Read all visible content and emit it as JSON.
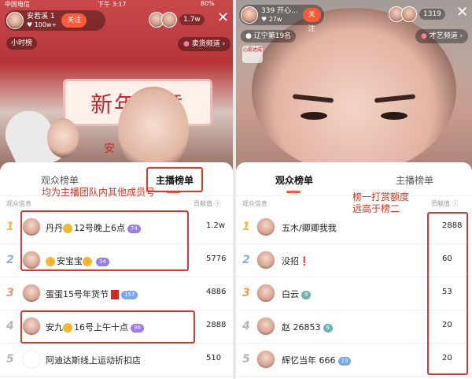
{
  "left": {
    "status": {
      "carrier": "中国电信",
      "time": "下午 3:17",
      "battery": "80%"
    },
    "host": {
      "name": "安若溪 1",
      "likes": "100w+",
      "follow": "关注"
    },
    "viewer_count": "1.7w",
    "close_icon": "✕",
    "hourly_tag": "小时榜",
    "channel": {
      "icon": "heart",
      "label": "卖货频道",
      "arrow": "›"
    },
    "banner_text": "新年立意",
    "banner_sub": "安",
    "tabs": {
      "audience": "观众榜单",
      "host": "主播榜单"
    },
    "header": {
      "info": "观众信息",
      "value": "贡献值 ⓘ"
    },
    "rows": [
      {
        "rank": "1",
        "rank_color": "#f3b63a",
        "name_pre": "丹丹",
        "name_post": "12号晚上6点",
        "level": "74",
        "level_kind": "p",
        "value": "1.2w",
        "emoji_pre": false,
        "emoji_mid": true,
        "emoji_post": false,
        "redbox": false
      },
      {
        "rank": "2",
        "rank_color": "#8fb0e6",
        "name_pre": "",
        "name_post": "安宝宝",
        "level": "34",
        "level_kind": "p",
        "value": "5776",
        "emoji_pre": true,
        "emoji_mid": false,
        "emoji_post": true,
        "redbox": false
      },
      {
        "rank": "3",
        "rank_color": "#e99b57",
        "name_pre": "",
        "name_post": "蛋蛋15号年货节",
        "level": "157",
        "level_kind": "b",
        "value": "4886",
        "emoji_pre": false,
        "emoji_mid": false,
        "emoji_post": false,
        "redbox": true
      },
      {
        "rank": "4",
        "rank_color": "#b5b5b5",
        "name_pre": "安九",
        "name_post": "16号上午十点",
        "level": "96",
        "level_kind": "p",
        "value": "2888",
        "emoji_pre": false,
        "emoji_mid": true,
        "emoji_post": false,
        "redbox": false
      },
      {
        "rank": "5",
        "rank_color": "#b5b5b5",
        "name_pre": "",
        "name_post": "阿迪达斯线上运动折扣店",
        "level": "",
        "level_kind": "",
        "value": "510",
        "emoji_pre": false,
        "emoji_mid": false,
        "emoji_post": false,
        "redbox": false
      }
    ],
    "annotation": "均为主播团队内其他成员号"
  },
  "right": {
    "host": {
      "name": "339 开心...",
      "likes": "27w",
      "follow": "关注"
    },
    "viewer_count": "1319",
    "close_icon": "✕",
    "region_tag": "辽宁第19名",
    "badge": "心愿达成",
    "channel": {
      "icon": "heart",
      "label": "才艺频道",
      "arrow": "›"
    },
    "tabs": {
      "audience": "观众榜单",
      "host": "主播榜单"
    },
    "header": {
      "info": "观众信息",
      "value": "贡献值 ⓘ"
    },
    "rows": [
      {
        "rank": "1",
        "rank_color": "#f3b63a",
        "name": "五木/卿卿我我",
        "level": "",
        "level_kind": "",
        "value": "2888",
        "mark": ""
      },
      {
        "rank": "2",
        "rank_color": "#8fb0e6",
        "name": "没招",
        "level": "",
        "level_kind": "",
        "value": "60",
        "mark": "❗"
      },
      {
        "rank": "3",
        "rank_color": "#e99b57",
        "name": "白云",
        "level": "9",
        "level_kind": "t",
        "value": "53",
        "mark": ""
      },
      {
        "rank": "4",
        "rank_color": "#b5b5b5",
        "name": "赵 26853",
        "level": "9",
        "level_kind": "t",
        "value": "20",
        "mark": ""
      },
      {
        "rank": "5",
        "rank_color": "#b5b5b5",
        "name": "辉忆当年 666",
        "level": "23",
        "level_kind": "b",
        "value": "20",
        "mark": ""
      }
    ],
    "annotation_line1": "榜一打赏额度",
    "annotation_line2": "远高于榜二"
  }
}
